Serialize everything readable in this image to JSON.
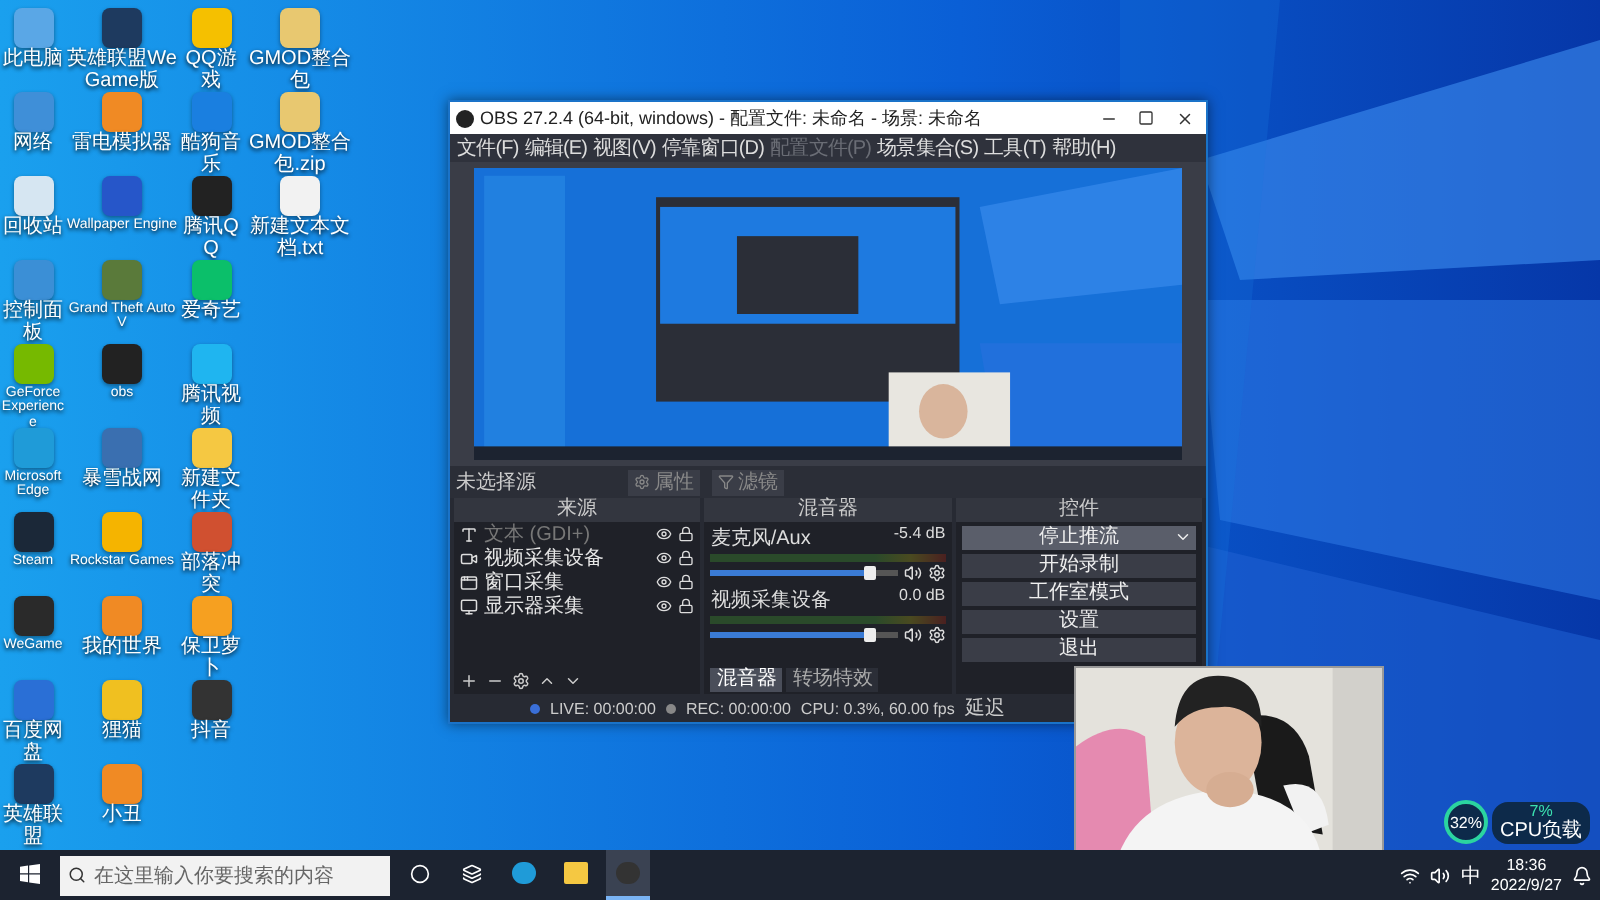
{
  "desktop": {
    "columns": [
      {
        "icons": [
          {
            "label": "此电脑",
            "color": "#5aa7e6"
          },
          {
            "label": "网络",
            "color": "#3f8fd8"
          },
          {
            "label": "回收站",
            "color": "#d6e6f2"
          },
          {
            "label": "控制面板",
            "color": "#3b8fd6"
          },
          {
            "label": "GeForce Experience",
            "color": "#76b900"
          },
          {
            "label": "Microsoft Edge",
            "color": "#1f9bd8"
          },
          {
            "label": "Steam",
            "color": "#1b2838"
          },
          {
            "label": "WeGame",
            "color": "#2a2a2a"
          },
          {
            "label": "百度网盘",
            "color": "#2a6fd6"
          },
          {
            "label": "英雄联盟",
            "color": "#1e3a5f"
          }
        ]
      },
      {
        "icons": [
          {
            "label": "英雄联盟WeGame版",
            "color": "#1e3a5f"
          },
          {
            "label": "雷电模拟器",
            "color": "#f08a24"
          },
          {
            "label": "Wallpaper Engine",
            "color": "#2656c9"
          },
          {
            "label": "Grand Theft Auto V",
            "color": "#5a7a3a"
          },
          {
            "label": "obs",
            "color": "#222222"
          },
          {
            "label": "暴雪战网",
            "color": "#3a6fb0"
          },
          {
            "label": "Rockstar Games",
            "color": "#f5b400"
          },
          {
            "label": "我的世界",
            "color": "#f08a24"
          },
          {
            "label": "狸猫",
            "color": "#f0c020"
          },
          {
            "label": "小丑",
            "color": "#f08a24"
          }
        ]
      },
      {
        "icons": [
          {
            "label": "QQ游戏",
            "color": "#f5c000"
          },
          {
            "label": "酷狗音乐",
            "color": "#1a7fe0"
          },
          {
            "label": "腾讯QQ",
            "color": "#222222"
          },
          {
            "label": "爱奇艺",
            "color": "#0bbf6a"
          },
          {
            "label": "腾讯视频",
            "color": "#1fb5f0"
          },
          {
            "label": "新建文件夹",
            "color": "#f5c842"
          },
          {
            "label": "部落冲突",
            "color": "#d05030"
          },
          {
            "label": "保卫萝卜",
            "color": "#f6a020"
          },
          {
            "label": "抖音",
            "color": "#333333"
          }
        ]
      },
      {
        "icons": [
          {
            "label": "GMOD整合包",
            "color": "#e8c870"
          },
          {
            "label": "GMOD整合包.zip",
            "color": "#e8c870"
          },
          {
            "label": "新建文本文档.txt",
            "color": "#f2f2f2"
          }
        ]
      }
    ]
  },
  "obs_window": {
    "title": "OBS 27.2.4 (64-bit, windows) - 配置文件: 未命名 - 场景: 未命名",
    "menu": [
      {
        "label": "文件(F)",
        "disabled": false
      },
      {
        "label": "编辑(E)",
        "disabled": false
      },
      {
        "label": "视图(V)",
        "disabled": false
      },
      {
        "label": "停靠窗口(D)",
        "disabled": false
      },
      {
        "label": "配置文件(P)",
        "disabled": true
      },
      {
        "label": "场景集合(S)",
        "disabled": false
      },
      {
        "label": "工具(T)",
        "disabled": false
      },
      {
        "label": "帮助(H)",
        "disabled": false
      }
    ],
    "source_toolbar": {
      "status": "未选择源",
      "buttons": [
        {
          "label": "属性",
          "kind": "gear"
        },
        {
          "label": "滤镜",
          "kind": "filter"
        }
      ]
    },
    "sources": {
      "title": "来源",
      "items": [
        {
          "name": "文本 (GDI+)",
          "kind": "text",
          "disabled": true
        },
        {
          "name": "视频采集设备",
          "kind": "camera",
          "disabled": false
        },
        {
          "name": "窗口采集",
          "kind": "window",
          "disabled": false
        },
        {
          "name": "显示器采集",
          "kind": "display",
          "disabled": false
        }
      ]
    },
    "mixer": {
      "title": "混音器",
      "channels": [
        {
          "name": "麦克风/Aux",
          "reading": "-5.4 dB",
          "volume": {
            "level": 0.85
          }
        },
        {
          "name": "视频采集设备",
          "reading": "0.0 dB",
          "volume": {
            "level": 0.85
          }
        }
      ],
      "tabs": [
        {
          "label": "混音器",
          "selected": true
        },
        {
          "label": "转场特效",
          "selected": false
        }
      ]
    },
    "controls": {
      "title": "控件",
      "buttons": [
        {
          "label": "停止推流",
          "highlighted": true
        },
        {
          "label": "开始录制",
          "highlighted": false
        },
        {
          "label": "工作室模式",
          "highlighted": false
        },
        {
          "label": "设置",
          "highlighted": false
        },
        {
          "label": "退出",
          "highlighted": false
        }
      ]
    },
    "status_bar": [
      "LIVE: 00:00:00",
      "REC: 00:00:00",
      "CPU: 0.3%, 60.00 fps",
      "延迟"
    ]
  },
  "cpu_widget": {
    "usage": "32%",
    "load": "7%",
    "label": "CPU负载"
  },
  "taskbar": {
    "search": {
      "placeholder": "在这里输入你要搜索的内容"
    },
    "apps": [
      {
        "kind": "edge",
        "running": false
      },
      {
        "kind": "folder",
        "running": false
      },
      {
        "kind": "obs",
        "running": true
      }
    ],
    "tray": {
      "ime": "中",
      "time": "18:36",
      "date": "2022/9/27"
    }
  }
}
